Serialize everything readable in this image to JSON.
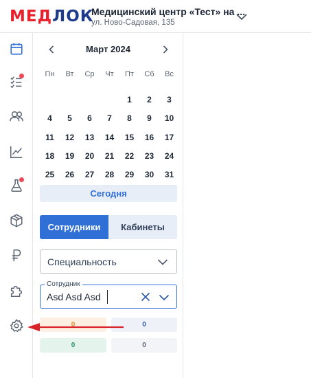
{
  "header": {
    "logo_part1": "МЕД",
    "logo_part2": "ЛОК",
    "clinic_name": "Медицинский центр «Тест» на ...",
    "clinic_address": "ул. Ново-Садовая, 135"
  },
  "sidebar": {
    "items": [
      {
        "icon": "calendar-icon",
        "active": true
      },
      {
        "icon": "checklist-icon",
        "badge": true
      },
      {
        "icon": "users-icon"
      },
      {
        "icon": "chart-icon"
      },
      {
        "icon": "flask-icon",
        "badge": true
      },
      {
        "icon": "box-icon"
      },
      {
        "icon": "ruble-icon"
      },
      {
        "icon": "puzzle-icon"
      },
      {
        "icon": "gear-icon"
      }
    ]
  },
  "calendar": {
    "title": "Март 2024",
    "weekdays": [
      "Пн",
      "Вт",
      "Ср",
      "Чт",
      "Пт",
      "Сб",
      "Вс"
    ],
    "leading_blanks": 4,
    "days": [
      "1",
      "2",
      "3",
      "4",
      "5",
      "6",
      "7",
      "8",
      "9",
      "10",
      "11",
      "12",
      "13",
      "14",
      "15",
      "16",
      "17",
      "18",
      "19",
      "20",
      "21",
      "22",
      "23",
      "24",
      "25",
      "26",
      "27",
      "28",
      "29",
      "30",
      "31"
    ],
    "today_label": "Сегодня"
  },
  "tabs": {
    "employees": "Сотрудники",
    "rooms": "Кабинеты",
    "active": "employees"
  },
  "filters": {
    "specialty_value": "Специальность",
    "employee_label": "Сотрудник",
    "employee_value": "Asd Asd Asd"
  },
  "stats": {
    "orange": "0",
    "blue": "0",
    "green": "0",
    "gray": "0"
  },
  "colors": {
    "accent": "#2f6fd6",
    "logo_red": "#e8212d",
    "logo_blue": "#1e3a8a",
    "badge": "#ef4956",
    "annotation": "#d9232b"
  }
}
